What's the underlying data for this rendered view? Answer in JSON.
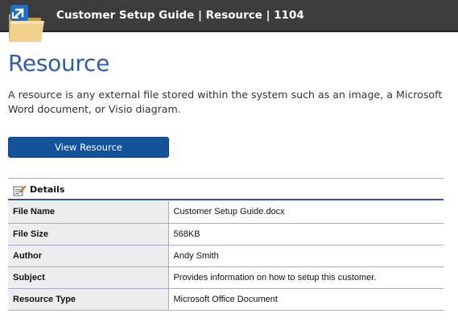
{
  "header": {
    "title": "Customer Setup Guide | Resource | 1104",
    "logo_icon": "folder-link-icon"
  },
  "page": {
    "title": "Resource",
    "description": "A resource is any external file stored within the system such as an image, a Microsoft Word document, or Visio diagram."
  },
  "actions": {
    "view_label": "View Resource"
  },
  "details": {
    "label": "Details",
    "icon": "details-note-icon",
    "rows": [
      {
        "key": "File Name",
        "value": "Customer Setup Guide.docx"
      },
      {
        "key": "File Size",
        "value": "568KB"
      },
      {
        "key": "Author",
        "value": "Andy Smith"
      },
      {
        "key": "Subject",
        "value": "Provides information on how to setup this customer."
      },
      {
        "key": "Resource Type",
        "value": "Microsoft Office Document"
      }
    ]
  },
  "colors": {
    "header_bg": "#3c3c3c",
    "title_blue": "#2e5ea8",
    "button_blue": "#12539c",
    "row_label_bg": "#ededed"
  }
}
